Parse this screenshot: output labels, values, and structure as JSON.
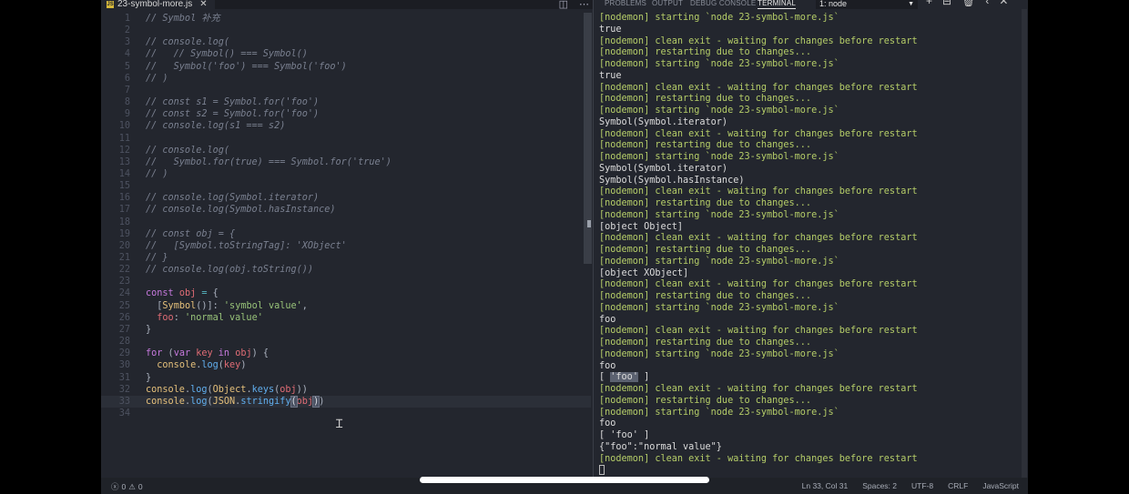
{
  "editor": {
    "tab_title": "23-symbol-more.js",
    "lines": [
      {
        "n": "1",
        "html": "<span class='c'>// Symbol 补充</span>"
      },
      {
        "n": "2",
        "html": ""
      },
      {
        "n": "3",
        "html": "<span class='c'>// console.log(</span>"
      },
      {
        "n": "4",
        "html": "<span class='c'>//   // Symbol() === Symbol()</span>"
      },
      {
        "n": "5",
        "html": "<span class='c'>//   Symbol('foo') === Symbol('foo')</span>"
      },
      {
        "n": "6",
        "html": "<span class='c'>// )</span>"
      },
      {
        "n": "7",
        "html": ""
      },
      {
        "n": "8",
        "html": "<span class='c'>// const s1 = Symbol.for('foo')</span>"
      },
      {
        "n": "9",
        "html": "<span class='c'>// const s2 = Symbol.for('foo')</span>"
      },
      {
        "n": "10",
        "html": "<span class='c'>// console.log(s1 === s2)</span>"
      },
      {
        "n": "11",
        "html": ""
      },
      {
        "n": "12",
        "html": "<span class='c'>// console.log(</span>"
      },
      {
        "n": "13",
        "html": "<span class='c'>//   Symbol.for(true) === Symbol.for('true')</span>"
      },
      {
        "n": "14",
        "html": "<span class='c'>// )</span>"
      },
      {
        "n": "15",
        "html": ""
      },
      {
        "n": "16",
        "html": "<span class='c'>// console.log(Symbol.iterator)</span>"
      },
      {
        "n": "17",
        "html": "<span class='c'>// console.log(Symbol.hasInstance)</span>"
      },
      {
        "n": "18",
        "html": ""
      },
      {
        "n": "19",
        "html": "<span class='c'>// const obj = {</span>"
      },
      {
        "n": "20",
        "html": "<span class='c'>//   [Symbol.toStringTag]: 'XObject'</span>"
      },
      {
        "n": "21",
        "html": "<span class='c'>// }</span>"
      },
      {
        "n": "22",
        "html": "<span class='c'>// console.log(obj.toString())</span>"
      },
      {
        "n": "23",
        "html": ""
      },
      {
        "n": "24",
        "html": "<span class='k'>const</span> <span class='v'>obj</span> <span class='o'>=</span> <span class='p'>{</span>"
      },
      {
        "n": "25",
        "html": "  <span class='p'>[</span><span class='t'>Symbol</span><span class='p'>()]:</span> <span class='s'>'symbol value'</span><span class='p'>,</span>"
      },
      {
        "n": "26",
        "html": "  <span class='v'>foo</span><span class='p'>:</span> <span class='s'>'normal value'</span>"
      },
      {
        "n": "27",
        "html": "<span class='p'>}</span>"
      },
      {
        "n": "28",
        "html": ""
      },
      {
        "n": "29",
        "html": "<span class='k'>for</span> <span class='p'>(</span><span class='k'>var</span> <span class='v'>key</span> <span class='k'>in</span> <span class='v'>obj</span><span class='p'>) {</span>"
      },
      {
        "n": "30",
        "html": "  <span class='t'>console</span><span class='p'>.</span><span class='f'>log</span><span class='p'>(</span><span class='v'>key</span><span class='p'>)</span>"
      },
      {
        "n": "31",
        "html": "<span class='p'>}</span>"
      },
      {
        "n": "32",
        "html": "<span class='t'>console</span><span class='p'>.</span><span class='f'>log</span><span class='p'>(</span><span class='t'>Object</span><span class='p'>.</span><span class='f'>keys</span><span class='p'>(</span><span class='v'>obj</span><span class='p'>))</span>"
      },
      {
        "n": "33",
        "html": "<span class='t'>console</span><span class='p'>.</span><span class='f'>log</span><span class='p'>(</span><span class='t'>JSON</span><span class='p'>.</span><span class='f'>stringify</span><span class='hl'>(</span><span class='v'>obj</span><span class='hl'>)</span><span class='p'>)</span>"
      },
      {
        "n": "34",
        "html": ""
      }
    ]
  },
  "panel": {
    "tabs": [
      "PROBLEMS",
      "OUTPUT",
      "DEBUG CONSOLE",
      "TERMINAL"
    ],
    "terminal_select": "1: node",
    "terminal_lines": [
      {
        "cls": "nm",
        "t": "[nodemon] starting `node 23-symbol-more.js`"
      },
      {
        "cls": "pl",
        "t": "true"
      },
      {
        "cls": "nm",
        "t": "[nodemon] clean exit - waiting for changes before restart"
      },
      {
        "cls": "nm",
        "t": "[nodemon] restarting due to changes..."
      },
      {
        "cls": "nm",
        "t": "[nodemon] starting `node 23-symbol-more.js`"
      },
      {
        "cls": "pl",
        "t": "true"
      },
      {
        "cls": "nm",
        "t": "[nodemon] clean exit - waiting for changes before restart"
      },
      {
        "cls": "nm",
        "t": "[nodemon] restarting due to changes..."
      },
      {
        "cls": "nm",
        "t": "[nodemon] starting `node 23-symbol-more.js`"
      },
      {
        "cls": "pl",
        "t": "Symbol(Symbol.iterator)"
      },
      {
        "cls": "nm",
        "t": "[nodemon] clean exit - waiting for changes before restart"
      },
      {
        "cls": "nm",
        "t": "[nodemon] restarting due to changes..."
      },
      {
        "cls": "nm",
        "t": "[nodemon] starting `node 23-symbol-more.js`"
      },
      {
        "cls": "pl",
        "t": "Symbol(Symbol.iterator)"
      },
      {
        "cls": "pl",
        "t": "Symbol(Symbol.hasInstance)"
      },
      {
        "cls": "nm",
        "t": "[nodemon] clean exit - waiting for changes before restart"
      },
      {
        "cls": "nm",
        "t": "[nodemon] restarting due to changes..."
      },
      {
        "cls": "nm",
        "t": "[nodemon] starting `node 23-symbol-more.js`"
      },
      {
        "cls": "pl",
        "t": "[object Object]"
      },
      {
        "cls": "nm",
        "t": "[nodemon] clean exit - waiting for changes before restart"
      },
      {
        "cls": "nm",
        "t": "[nodemon] restarting due to changes..."
      },
      {
        "cls": "nm",
        "t": "[nodemon] starting `node 23-symbol-more.js`"
      },
      {
        "cls": "pl",
        "t": "[object XObject]"
      },
      {
        "cls": "nm",
        "t": "[nodemon] clean exit - waiting for changes before restart"
      },
      {
        "cls": "nm",
        "t": "[nodemon] restarting due to changes..."
      },
      {
        "cls": "nm",
        "t": "[nodemon] starting `node 23-symbol-more.js`"
      },
      {
        "cls": "pl",
        "t": "foo"
      },
      {
        "cls": "nm",
        "t": "[nodemon] clean exit - waiting for changes before restart"
      },
      {
        "cls": "nm",
        "t": "[nodemon] restarting due to changes..."
      },
      {
        "cls": "nm",
        "t": "[nodemon] starting `node 23-symbol-more.js`"
      },
      {
        "cls": "pl",
        "t": "foo"
      },
      {
        "cls": "pl",
        "t": "[ 'foo' ]",
        "sel": true
      },
      {
        "cls": "nm",
        "t": "[nodemon] clean exit - waiting for changes before restart"
      },
      {
        "cls": "nm",
        "t": "[nodemon] restarting due to changes..."
      },
      {
        "cls": "nm",
        "t": "[nodemon] starting `node 23-symbol-more.js`"
      },
      {
        "cls": "pl",
        "t": "foo"
      },
      {
        "cls": "pl",
        "t": "[ 'foo' ]"
      },
      {
        "cls": "pl",
        "t": "{\"foo\":\"normal value\"}"
      },
      {
        "cls": "nm",
        "t": "[nodemon] clean exit - waiting for changes before restart"
      }
    ]
  },
  "status": {
    "errors": "0",
    "warnings": "0",
    "cursor_position": "Ln 33, Col 31",
    "indent": "Spaces: 2",
    "encoding": "UTF-8",
    "eol": "CRLF",
    "language": "JavaScript"
  },
  "colors": {
    "accent_terminal": "#b5cd68",
    "background": "#23262e"
  }
}
